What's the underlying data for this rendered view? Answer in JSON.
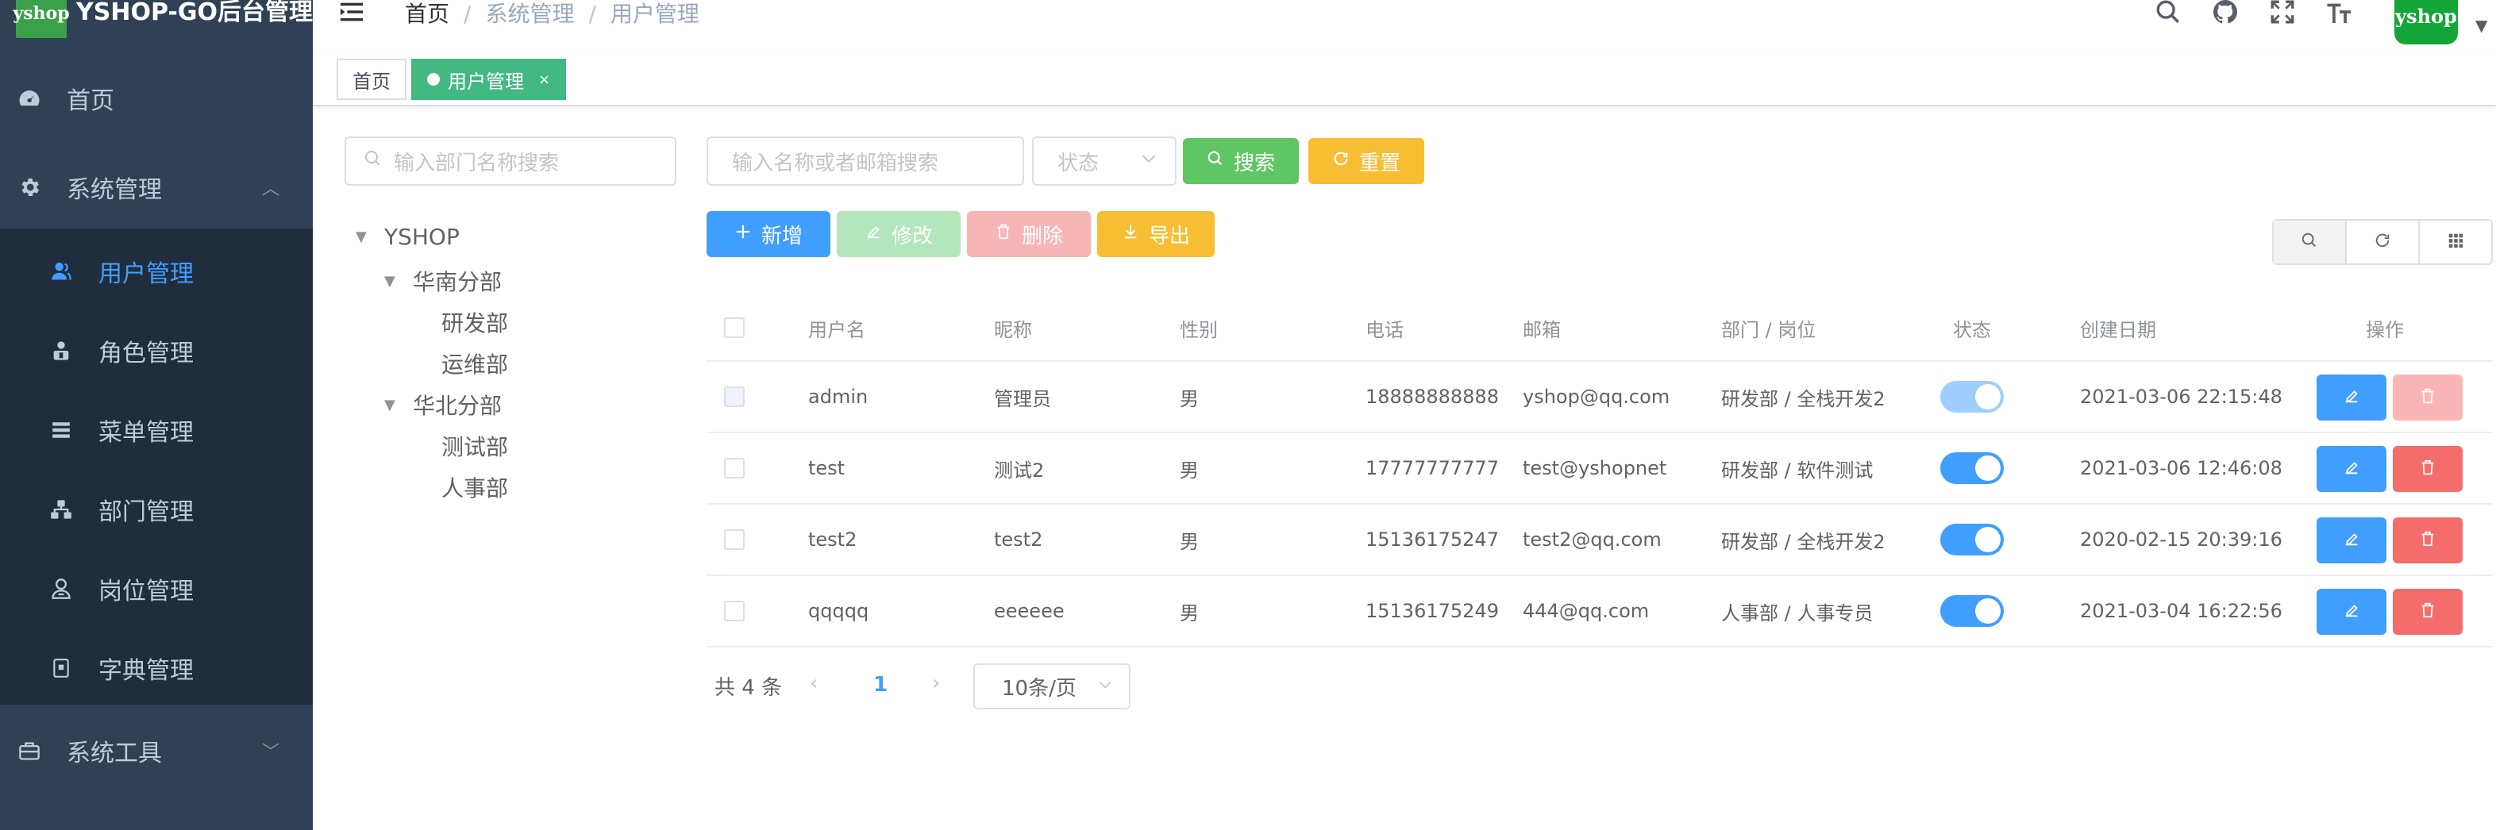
{
  "app": {
    "title": "YSHOP-GO后台管理",
    "logo_text": "yshop",
    "avatar_text": "yshop"
  },
  "colors": {
    "sidebar_bg": "#304156",
    "primary": "#409eff",
    "success": "#5ec764",
    "warning": "#f7be34",
    "danger": "#f56c6c",
    "tag_active": "#42b983"
  },
  "sidebar": {
    "home": {
      "label": "首页",
      "icon": "dashboard-icon"
    },
    "system": {
      "label": "系统管理",
      "icon": "gear-icon",
      "expanded": true
    },
    "items": [
      {
        "label": "用户管理",
        "icon": "user-icon",
        "active": true
      },
      {
        "label": "角色管理",
        "icon": "role-icon"
      },
      {
        "label": "菜单管理",
        "icon": "menu-icon"
      },
      {
        "label": "部门管理",
        "icon": "dept-icon"
      },
      {
        "label": "岗位管理",
        "icon": "post-icon"
      },
      {
        "label": "字典管理",
        "icon": "dict-icon"
      }
    ],
    "tools": {
      "label": "系统工具",
      "icon": "toolbox-icon"
    }
  },
  "navbar": {
    "breadcrumb": [
      "首页",
      "系统管理",
      "用户管理"
    ],
    "icons": [
      "search-icon",
      "github-icon",
      "fullscreen-icon",
      "font-size-icon"
    ]
  },
  "tags": {
    "home": "首页",
    "active": "用户管理"
  },
  "dept_panel": {
    "search_placeholder": "输入部门名称搜索",
    "tree": [
      {
        "label": "YSHOP",
        "level": 0
      },
      {
        "label": "华南分部",
        "level": 1
      },
      {
        "label": "研发部",
        "level": 2
      },
      {
        "label": "运维部",
        "level": 2
      },
      {
        "label": "华北分部",
        "level": 1
      },
      {
        "label": "测试部",
        "level": 2
      },
      {
        "label": "人事部",
        "level": 2
      }
    ]
  },
  "query": {
    "name_placeholder": "输入名称或者邮箱搜索",
    "status_placeholder": "状态",
    "search_label": "搜索",
    "reset_label": "重置"
  },
  "toolbar": {
    "add": "新增",
    "edit": "修改",
    "delete": "删除",
    "export": "导出"
  },
  "table": {
    "columns": [
      "用户名",
      "昵称",
      "性别",
      "电话",
      "邮箱",
      "部门 / 岗位",
      "状态",
      "创建日期",
      "操作"
    ],
    "rows": [
      {
        "username": "admin",
        "nickname": "管理员",
        "gender": "男",
        "phone": "18888888888",
        "email": "yshop@qq.com",
        "dept": "研发部 / 全栈开发2",
        "enabled": true,
        "created": "2021-03-06 22:15:48",
        "locked": true
      },
      {
        "username": "test",
        "nickname": "测试2",
        "gender": "男",
        "phone": "17777777777",
        "email": "test@yshopnet",
        "dept": "研发部 / 软件测试",
        "enabled": true,
        "created": "2021-03-06 12:46:08",
        "locked": false
      },
      {
        "username": "test2",
        "nickname": "test2",
        "gender": "男",
        "phone": "15136175247",
        "email": "test2@qq.com",
        "dept": "研发部 / 全栈开发2",
        "enabled": true,
        "created": "2020-02-15 20:39:16",
        "locked": false
      },
      {
        "username": "qqqqq",
        "nickname": "eeeeee",
        "gender": "男",
        "phone": "15136175249",
        "email": "444@qq.com",
        "dept": "人事部 / 人事专员",
        "enabled": true,
        "created": "2021-03-04 16:22:56",
        "locked": false
      }
    ]
  },
  "pagination": {
    "total_text": "共 4 条",
    "current": "1",
    "page_size": "10条/页"
  }
}
